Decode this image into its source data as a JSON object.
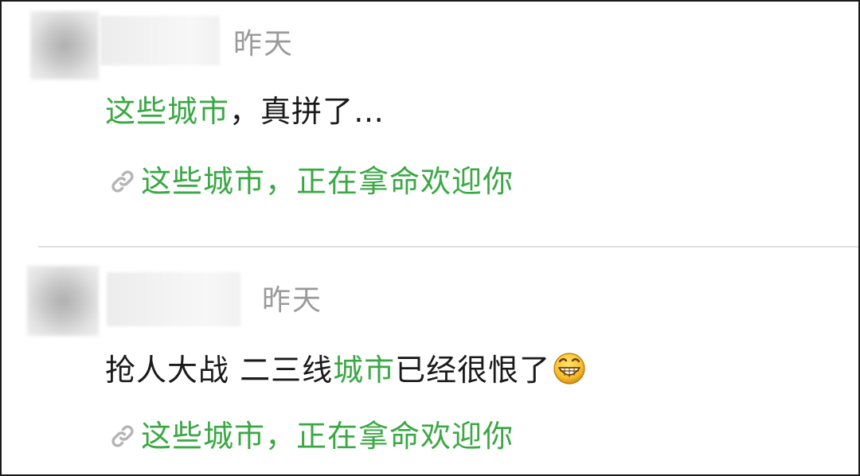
{
  "posts": [
    {
      "timestamp": "昨天",
      "content_highlight": "这些城市",
      "content_rest": "，真拼了…",
      "link_text": "这些城市，正在拿命欢迎你"
    },
    {
      "timestamp": "昨天",
      "content_before": "抢人大战 二三线",
      "content_highlight": "城市",
      "content_after": "已经很恨了",
      "emoji": "grinning-face-icon",
      "link_text": "这些城市，正在拿命欢迎你"
    }
  ],
  "colors": {
    "highlight": "#3aa844",
    "timestamp": "#9a9a9a",
    "text": "#1a1a1a",
    "divider": "#e1e1e1"
  }
}
